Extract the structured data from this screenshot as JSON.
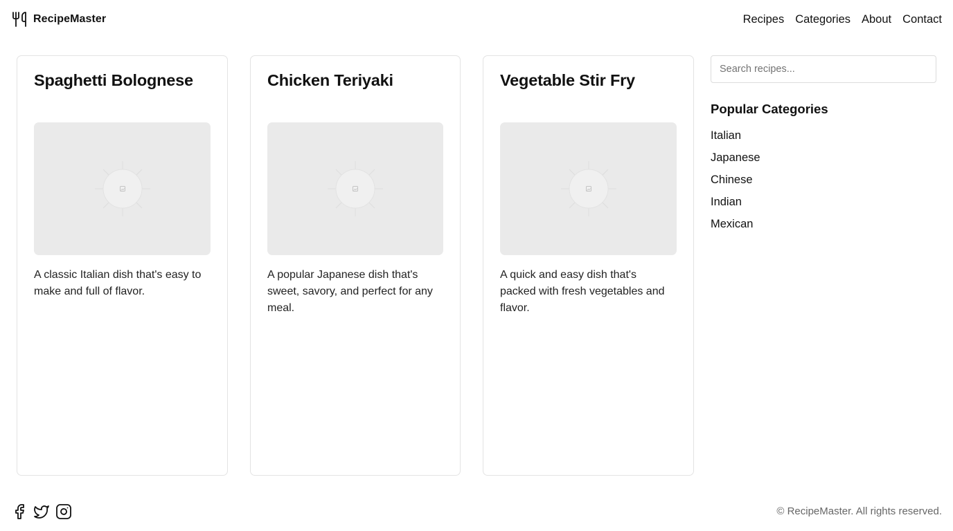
{
  "header": {
    "brand_icon": "utensils-icon",
    "brand_name": "RecipeMaster",
    "nav": [
      "Recipes",
      "Categories",
      "About",
      "Contact"
    ]
  },
  "recipes": [
    {
      "title": "Spaghetti Bolognese",
      "image_icon": "image-placeholder-icon",
      "description": "A classic Italian dish that's easy to make and full of flavor."
    },
    {
      "title": "Chicken Teriyaki",
      "image_icon": "image-placeholder-icon",
      "description": "A popular Japanese dish that's sweet, savory, and perfect for any meal."
    },
    {
      "title": "Vegetable Stir Fry",
      "image_icon": "image-placeholder-icon",
      "description": "A quick and easy dish that's packed with fresh vegetables and flavor."
    }
  ],
  "sidebar": {
    "search_placeholder": "Search recipes...",
    "search_value": "",
    "heading": "Popular Categories",
    "categories": [
      "Italian",
      "Japanese",
      "Chinese",
      "Indian",
      "Mexican"
    ]
  },
  "footer": {
    "social_icons": [
      "facebook-icon",
      "twitter-icon",
      "instagram-icon"
    ],
    "copyright": "© RecipeMaster. All rights reserved."
  },
  "colors": {
    "text": "#111111",
    "muted_text": "#666666",
    "card_border": "#e3e3e3",
    "image_placeholder": "#eaeaea"
  }
}
